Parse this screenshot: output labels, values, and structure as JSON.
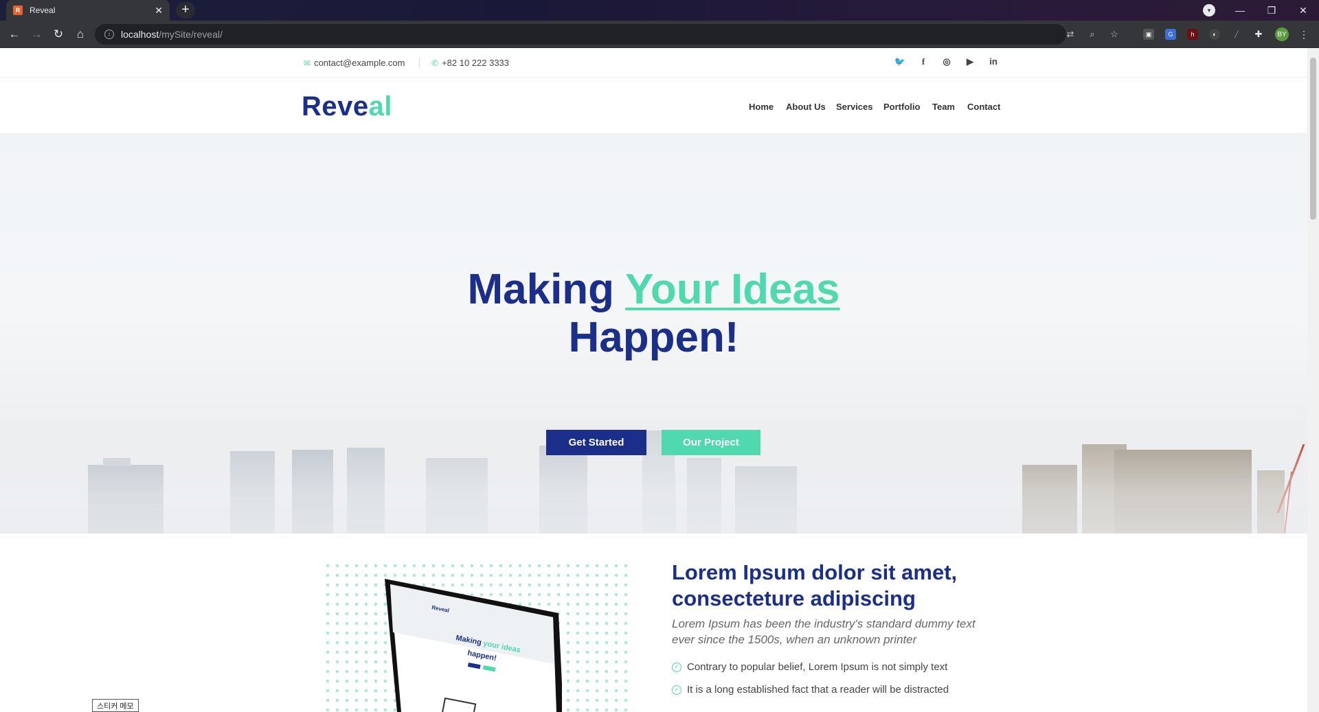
{
  "browser": {
    "tab_title": "Reveal",
    "tab_favicon_text": "R",
    "url_host": "localhost",
    "url_path": "/mySite/reveal/",
    "profile_initials": "BY"
  },
  "topbar": {
    "email": "contact@example.com",
    "phone": "+82 10 222 3333",
    "social_icons": [
      "twitter-icon",
      "facebook-icon",
      "instagram-icon",
      "youtube-icon",
      "linkedin-icon"
    ]
  },
  "header": {
    "logo_main": "Reve",
    "logo_accent": "al",
    "menu": [
      "Home",
      "About Us",
      "Services",
      "Portfolio",
      "Team",
      "Contact"
    ]
  },
  "hero": {
    "title_start": "Making ",
    "title_highlight": "Your Ideas",
    "title_end": "Happen!",
    "primary_button": "Get Started",
    "secondary_button": "Our Project"
  },
  "about": {
    "title": "Lorem Ipsum dolor sit amet, consecteture adipiscing",
    "lead": "Lorem Ipsum has been the industry's standard dummy text ever since the 1500s, when an unknown printer",
    "items": [
      "Contrary to popular belief, Lorem Ipsum is not simply text",
      "It is a long established fact that a reader will be distracted"
    ]
  },
  "taskbar": {
    "sticker_label": "스티커 메모"
  },
  "colors": {
    "brand_navy": "#1a2e8a",
    "brand_accent": "#50d8af"
  }
}
